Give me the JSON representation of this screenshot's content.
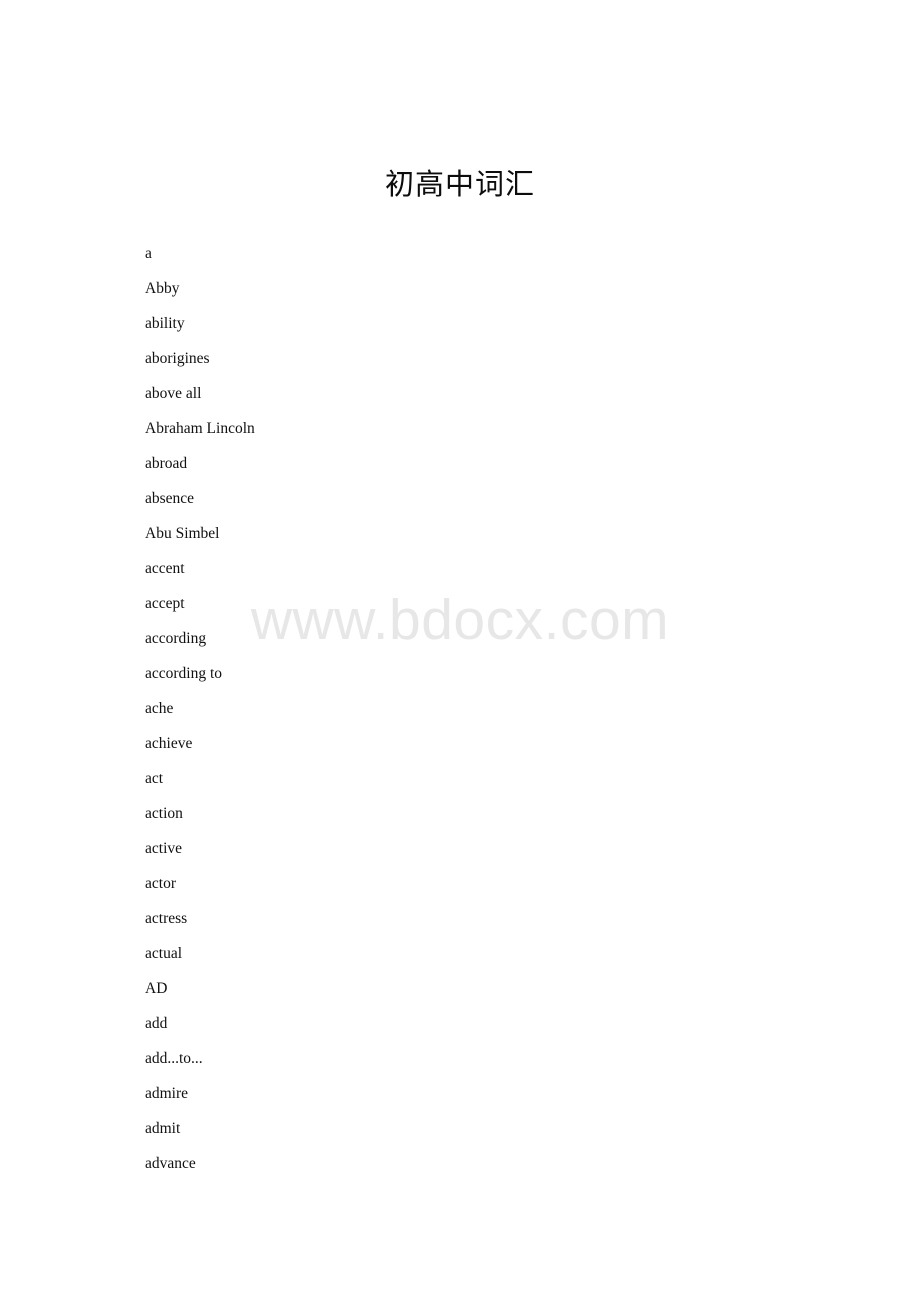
{
  "document": {
    "title": "初高中词汇",
    "page_background": "#ffffff",
    "text_color": "#111111"
  },
  "watermark": {
    "text": "www.bdocx.com",
    "color": "#e7e7e7"
  },
  "word_list": [
    {
      "term": "a"
    },
    {
      "term": "Abby"
    },
    {
      "term": "ability"
    },
    {
      "term": "aborigines"
    },
    {
      "term": "above all"
    },
    {
      "term": "Abraham Lincoln"
    },
    {
      "term": "abroad"
    },
    {
      "term": "absence"
    },
    {
      "term": "Abu Simbel"
    },
    {
      "term": "accent"
    },
    {
      "term": "accept"
    },
    {
      "term": "according"
    },
    {
      "term": "according to"
    },
    {
      "term": "ache"
    },
    {
      "term": "achieve"
    },
    {
      "term": "act"
    },
    {
      "term": "action"
    },
    {
      "term": "active"
    },
    {
      "term": "actor"
    },
    {
      "term": "actress"
    },
    {
      "term": "actual"
    },
    {
      "term": "AD"
    },
    {
      "term": "add"
    },
    {
      "term": "add...to..."
    },
    {
      "term": "admire"
    },
    {
      "term": "admit"
    },
    {
      "term": "advance"
    }
  ]
}
